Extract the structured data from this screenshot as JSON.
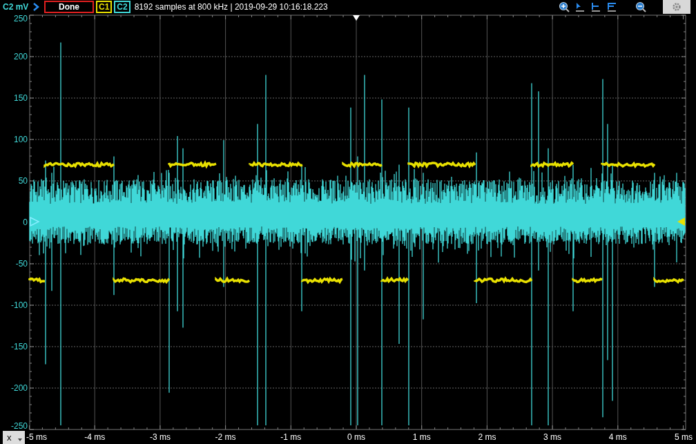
{
  "header": {
    "axis_label": "C2 mV",
    "status": "Done",
    "info": "8192 samples at 800 kHz | 2019-09-29 10:16:18.223",
    "channels": [
      {
        "label": "C1",
        "color": "#e8e000"
      },
      {
        "label": "C2",
        "color": "#40d8d8"
      }
    ]
  },
  "y_axis": {
    "ticks": [
      "250",
      "200",
      "150",
      "100",
      "50",
      "0",
      "-50",
      "-100",
      "-150",
      "-200",
      "-250"
    ]
  },
  "x_axis": {
    "menu": "x",
    "ticks": [
      "-5 ms",
      "-4 ms",
      "-3 ms",
      "-2 ms",
      "-1 ms",
      "0 ms",
      "1 ms",
      "2 ms",
      "3 ms",
      "4 ms",
      "5 ms"
    ]
  }
}
